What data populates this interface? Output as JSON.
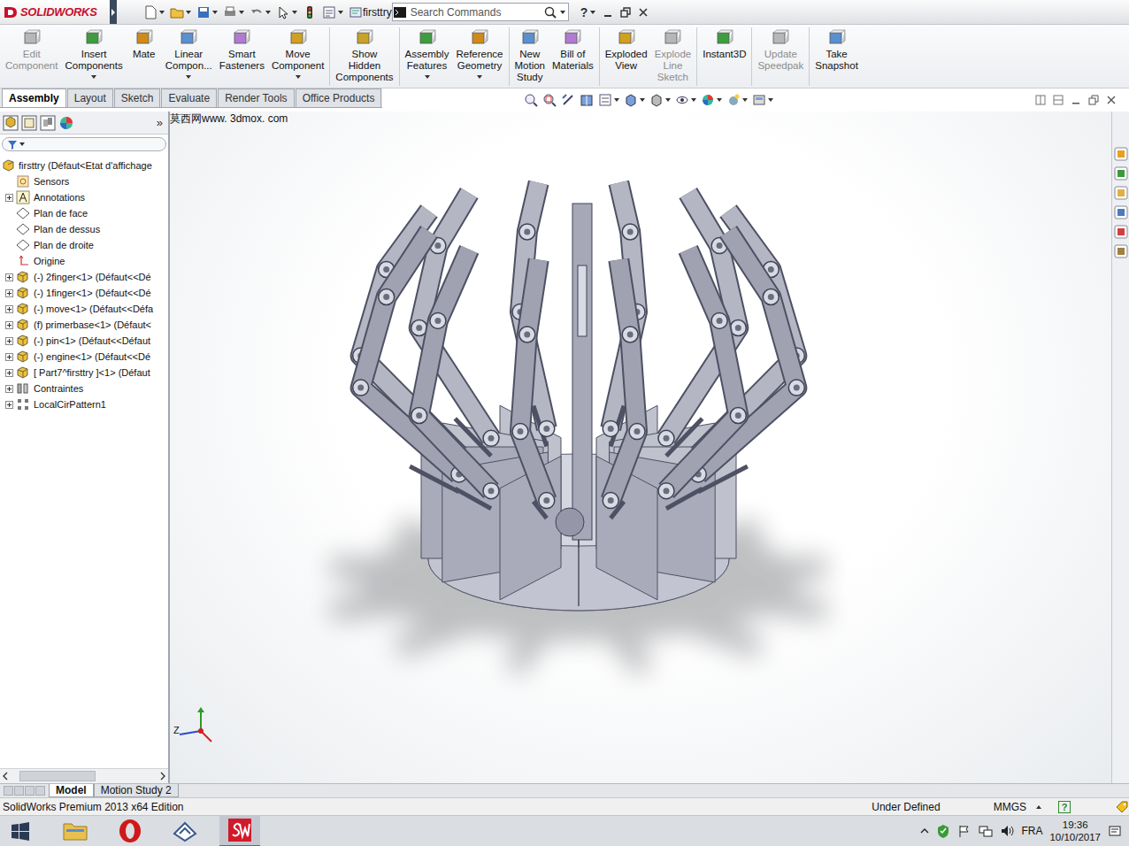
{
  "window": {
    "app": "SOLIDWORKS",
    "title": "firsttry",
    "search": {
      "placeholder": "Search Commands"
    },
    "help": "?"
  },
  "ribbon": {
    "buttons": [
      {
        "lines": [
          "Edit",
          "Component"
        ],
        "disabled": true,
        "dropdown": false,
        "group": 0
      },
      {
        "lines": [
          "Insert",
          "Components"
        ],
        "disabled": false,
        "dropdown": true,
        "group": 0
      },
      {
        "lines": [
          "Mate"
        ],
        "disabled": false,
        "dropdown": false,
        "group": 0
      },
      {
        "lines": [
          "Linear",
          "Compon..."
        ],
        "disabled": false,
        "dropdown": true,
        "group": 0
      },
      {
        "lines": [
          "Smart",
          "Fasteners"
        ],
        "disabled": false,
        "dropdown": false,
        "group": 0
      },
      {
        "lines": [
          "Move",
          "Component"
        ],
        "disabled": false,
        "dropdown": true,
        "group": 0
      },
      {
        "lines": [
          "Show",
          "Hidden",
          "Components"
        ],
        "disabled": false,
        "dropdown": false,
        "group": 1
      },
      {
        "lines": [
          "Assembly",
          "Features"
        ],
        "disabled": false,
        "dropdown": true,
        "group": 2
      },
      {
        "lines": [
          "Reference",
          "Geometry"
        ],
        "disabled": false,
        "dropdown": true,
        "group": 2
      },
      {
        "lines": [
          "New",
          "Motion",
          "Study"
        ],
        "disabled": false,
        "dropdown": false,
        "group": 3
      },
      {
        "lines": [
          "Bill of",
          "Materials"
        ],
        "disabled": false,
        "dropdown": false,
        "group": 3
      },
      {
        "lines": [
          "Exploded",
          "View"
        ],
        "disabled": false,
        "dropdown": false,
        "group": 4
      },
      {
        "lines": [
          "Explode",
          "Line",
          "Sketch"
        ],
        "disabled": true,
        "dropdown": false,
        "group": 4
      },
      {
        "lines": [
          "Instant3D"
        ],
        "disabled": false,
        "dropdown": false,
        "group": 5
      },
      {
        "lines": [
          "Update",
          "Speedpak"
        ],
        "disabled": true,
        "dropdown": false,
        "group": 6
      },
      {
        "lines": [
          "Take",
          "Snapshot"
        ],
        "disabled": false,
        "dropdown": false,
        "group": 7
      }
    ]
  },
  "tabs": [
    {
      "label": "Assembly",
      "selected": true
    },
    {
      "label": "Layout",
      "selected": false
    },
    {
      "label": "Sketch",
      "selected": false
    },
    {
      "label": "Evaluate",
      "selected": false
    },
    {
      "label": "Render Tools",
      "selected": false
    },
    {
      "label": "Office Products",
      "selected": false
    }
  ],
  "feature_tree": {
    "more": "»",
    "items": [
      {
        "label": "firsttry  (Défaut<Etat d'affichage",
        "kind": "assembly",
        "depth": 0,
        "expandable": false
      },
      {
        "label": "Sensors",
        "kind": "sensor",
        "depth": 1,
        "expandable": false
      },
      {
        "label": "Annotations",
        "kind": "annotation",
        "depth": 1,
        "expandable": true
      },
      {
        "label": "Plan de face",
        "kind": "plane",
        "depth": 1,
        "expandable": false
      },
      {
        "label": "Plan de dessus",
        "kind": "plane",
        "depth": 1,
        "expandable": false
      },
      {
        "label": "Plan de droite",
        "kind": "plane",
        "depth": 1,
        "expandable": false
      },
      {
        "label": "Origine",
        "kind": "origin",
        "depth": 1,
        "expandable": false
      },
      {
        "label": "(-) 2finger<1> (Défaut<<Dé",
        "kind": "part",
        "depth": 1,
        "expandable": true
      },
      {
        "label": "(-) 1finger<1> (Défaut<<Dé",
        "kind": "part",
        "depth": 1,
        "expandable": true
      },
      {
        "label": "(-) move<1> (Défaut<<Défa",
        "kind": "part",
        "depth": 1,
        "expandable": true
      },
      {
        "label": "(f) primerbase<1> (Défaut<",
        "kind": "part",
        "depth": 1,
        "expandable": true
      },
      {
        "label": "(-) pin<1> (Défaut<<Défaut",
        "kind": "part",
        "depth": 1,
        "expandable": true
      },
      {
        "label": "(-) engine<1> (Défaut<<Dé",
        "kind": "part",
        "depth": 1,
        "expandable": true
      },
      {
        "label": "[ Part7^firsttry ]<1> (Défaut",
        "kind": "part",
        "depth": 1,
        "expandable": true
      },
      {
        "label": "Contraintes",
        "kind": "mates",
        "depth": 1,
        "expandable": true
      },
      {
        "label": "LocalCirPattern1",
        "kind": "pattern",
        "depth": 1,
        "expandable": true
      }
    ]
  },
  "viewport": {
    "watermark": "莫西网www. 3dmox. com",
    "triad": {
      "z": "Z"
    }
  },
  "bottom_tabs": [
    {
      "label": "Model",
      "selected": true
    },
    {
      "label": "Motion Study 2",
      "selected": false
    }
  ],
  "status_bar": {
    "edition": "SolidWorks Premium 2013 x64 Edition",
    "state": "Under Defined",
    "units": "MMGS",
    "help": "?"
  },
  "taskbar": {
    "language": "FRA",
    "time": "19:36",
    "date": "10/10/2017"
  }
}
